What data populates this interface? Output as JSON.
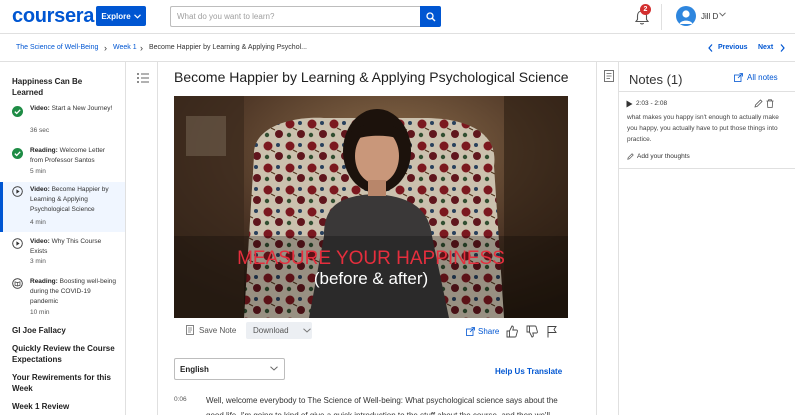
{
  "header": {
    "logo": "coursera",
    "explore_label": "Explore",
    "search_placeholder": "What do you want to learn?",
    "notification_count": "2",
    "user_name": "Jill D"
  },
  "breadcrumb": {
    "items": [
      "The Science of Well-Being",
      "Week 1",
      "Become Happier by Learning & Applying Psychol..."
    ],
    "previous": "Previous",
    "next": "Next"
  },
  "sidebar": {
    "section_title": "Happiness Can Be Learned",
    "items": [
      {
        "kind": "Video:",
        "title": "Start a New Journey!",
        "duration": "36 sec",
        "status": "done"
      },
      {
        "kind": "Reading:",
        "title": "Welcome Letter from Professor Santos",
        "duration": "5 min",
        "status": "done"
      },
      {
        "kind": "Video:",
        "title": "Become Happier by Learning & Applying Psychological Science",
        "duration": "4 min",
        "status": "active"
      },
      {
        "kind": "Video:",
        "title": "Why This Course Exists",
        "duration": "3 min",
        "status": "todo"
      },
      {
        "kind": "Reading:",
        "title": "Boosting well-being during the COVID-19 pandemic",
        "duration": "10 min",
        "status": "todo"
      }
    ],
    "lessons": [
      "GI Joe Fallacy",
      "Quickly Review the Course Expectations",
      "Your Rewirements for this Week",
      "Week 1 Review"
    ]
  },
  "main": {
    "title": "Become Happier by Learning & Applying Psychological Science",
    "video_caption_line1": "MEASURE YOUR HAPPINESS",
    "video_caption_line2": "(before & after)",
    "save_note": "Save Note",
    "download": "Download",
    "share": "Share",
    "language": "English",
    "help_translate": "Help Us Translate",
    "transcript_time": "0:06",
    "transcript_text": "Well, welcome everybody to The Science of Well-being: What psychological science says about the good life. I'm going to kind of give a quick introduction to the stuff about the course, and then we'll"
  },
  "notes": {
    "title": "Notes (1)",
    "all_notes": "All notes",
    "note_time": "2:03 - 2:08",
    "note_text": "what makes you happy isn't enough to actually make you happy, you actually have to put those things into practice.",
    "add_thoughts": "Add your thoughts"
  },
  "colors": {
    "brand": "#0056d2",
    "badge": "#d32f2f",
    "done": "#1e8c45"
  }
}
